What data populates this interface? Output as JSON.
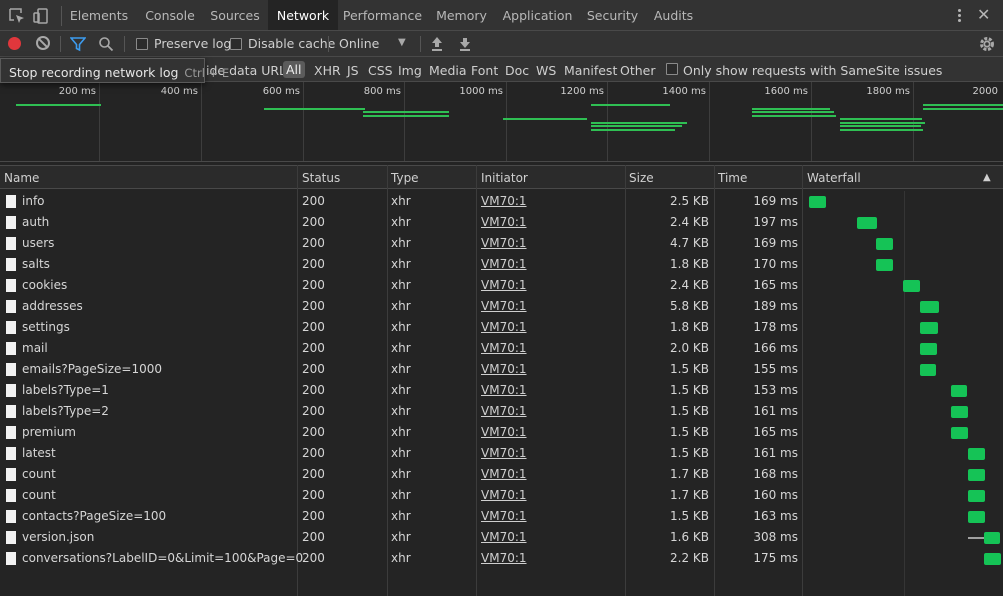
{
  "tabs": [
    {
      "label": "Elements",
      "active": false
    },
    {
      "label": "Console",
      "active": false
    },
    {
      "label": "Sources",
      "active": false
    },
    {
      "label": "Network",
      "active": true
    },
    {
      "label": "Performance",
      "active": false
    },
    {
      "label": "Memory",
      "active": false
    },
    {
      "label": "Application",
      "active": false
    },
    {
      "label": "Security",
      "active": false
    },
    {
      "label": "Audits",
      "active": false
    }
  ],
  "toolbar": {
    "preserve_log": "Preserve log",
    "disable_cache": "Disable cache",
    "throttle": "Online"
  },
  "tooltip": {
    "text": "Stop recording network log",
    "shortcut": "Ctrl + E"
  },
  "filter": {
    "hide_data_urls": "ide data URLs",
    "types": [
      "All",
      "XHR",
      "JS",
      "CSS",
      "Img",
      "Media",
      "Font",
      "Doc",
      "WS",
      "Manifest",
      "Other"
    ],
    "samesite": "Only show requests with SameSite issues"
  },
  "overview": {
    "ticks": [
      "200 ms",
      "400 ms",
      "600 ms",
      "800 ms",
      "1000 ms",
      "1200 ms",
      "1400 ms",
      "1600 ms",
      "1800 ms",
      "2000"
    ]
  },
  "columns": {
    "name": "Name",
    "status": "Status",
    "type": "Type",
    "initiator": "Initiator",
    "size": "Size",
    "time": "Time",
    "waterfall": "Waterfall"
  },
  "colors": {
    "record": "#e0373c",
    "bar": "#15c356",
    "accent": "#1a73e8"
  },
  "requests": [
    {
      "name": "info",
      "status": "200",
      "type": "xhr",
      "initiator": "VM70:1",
      "size": "2.5 KB",
      "time": "169 ms",
      "wf_start": 3,
      "wf_len": 17,
      "wait": 0
    },
    {
      "name": "auth",
      "status": "200",
      "type": "xhr",
      "initiator": "VM70:1",
      "size": "2.4 KB",
      "time": "197 ms",
      "wf_start": 51,
      "wf_len": 20,
      "wait": 0
    },
    {
      "name": "users",
      "status": "200",
      "type": "xhr",
      "initiator": "VM70:1",
      "size": "4.7 KB",
      "time": "169 ms",
      "wf_start": 70,
      "wf_len": 17,
      "wait": 0
    },
    {
      "name": "salts",
      "status": "200",
      "type": "xhr",
      "initiator": "VM70:1",
      "size": "1.8 KB",
      "time": "170 ms",
      "wf_start": 70,
      "wf_len": 17,
      "wait": 0
    },
    {
      "name": "cookies",
      "status": "200",
      "type": "xhr",
      "initiator": "VM70:1",
      "size": "2.4 KB",
      "time": "165 ms",
      "wf_start": 97,
      "wf_len": 17,
      "wait": 0
    },
    {
      "name": "addresses",
      "status": "200",
      "type": "xhr",
      "initiator": "VM70:1",
      "size": "5.8 KB",
      "time": "189 ms",
      "wf_start": 114,
      "wf_len": 19,
      "wait": 0
    },
    {
      "name": "settings",
      "status": "200",
      "type": "xhr",
      "initiator": "VM70:1",
      "size": "1.8 KB",
      "time": "178 ms",
      "wf_start": 114,
      "wf_len": 18,
      "wait": 0
    },
    {
      "name": "mail",
      "status": "200",
      "type": "xhr",
      "initiator": "VM70:1",
      "size": "2.0 KB",
      "time": "166 ms",
      "wf_start": 114,
      "wf_len": 17,
      "wait": 0
    },
    {
      "name": "emails?PageSize=1000",
      "status": "200",
      "type": "xhr",
      "initiator": "VM70:1",
      "size": "1.5 KB",
      "time": "155 ms",
      "wf_start": 114,
      "wf_len": 16,
      "wait": 0
    },
    {
      "name": "labels?Type=1",
      "status": "200",
      "type": "xhr",
      "initiator": "VM70:1",
      "size": "1.5 KB",
      "time": "153 ms",
      "wf_start": 145,
      "wf_len": 16,
      "wait": 0
    },
    {
      "name": "labels?Type=2",
      "status": "200",
      "type": "xhr",
      "initiator": "VM70:1",
      "size": "1.5 KB",
      "time": "161 ms",
      "wf_start": 145,
      "wf_len": 17,
      "wait": 0
    },
    {
      "name": "premium",
      "status": "200",
      "type": "xhr",
      "initiator": "VM70:1",
      "size": "1.5 KB",
      "time": "165 ms",
      "wf_start": 145,
      "wf_len": 17,
      "wait": 0
    },
    {
      "name": "latest",
      "status": "200",
      "type": "xhr",
      "initiator": "VM70:1",
      "size": "1.5 KB",
      "time": "161 ms",
      "wf_start": 162,
      "wf_len": 17,
      "wait": 0
    },
    {
      "name": "count",
      "status": "200",
      "type": "xhr",
      "initiator": "VM70:1",
      "size": "1.7 KB",
      "time": "168 ms",
      "wf_start": 162,
      "wf_len": 17,
      "wait": 0
    },
    {
      "name": "count",
      "status": "200",
      "type": "xhr",
      "initiator": "VM70:1",
      "size": "1.7 KB",
      "time": "160 ms",
      "wf_start": 162,
      "wf_len": 17,
      "wait": 0
    },
    {
      "name": "contacts?PageSize=100",
      "status": "200",
      "type": "xhr",
      "initiator": "VM70:1",
      "size": "1.5 KB",
      "time": "163 ms",
      "wf_start": 162,
      "wf_len": 17,
      "wait": 0
    },
    {
      "name": "version.json",
      "status": "200",
      "type": "xhr",
      "initiator": "VM70:1",
      "size": "1.6 KB",
      "time": "308 ms",
      "wf_start": 178,
      "wf_len": 16,
      "wait": 18
    },
    {
      "name": "conversations?LabelID=0&Limit=100&Page=0",
      "status": "200",
      "type": "xhr",
      "initiator": "VM70:1",
      "size": "2.2 KB",
      "time": "175 ms",
      "wf_start": 178,
      "wf_len": 17,
      "wait": 0
    }
  ]
}
